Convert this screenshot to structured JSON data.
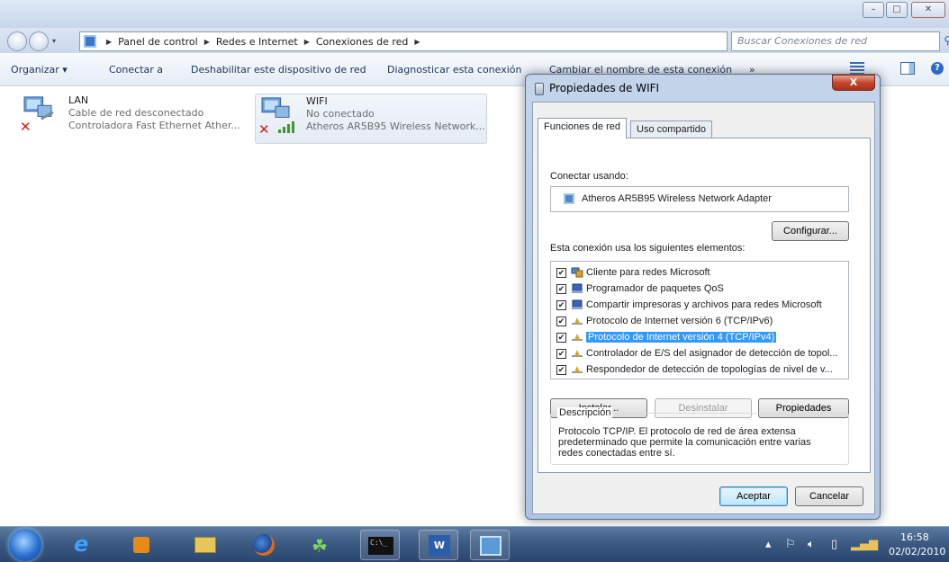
{
  "window": {
    "breadcrumb": [
      "Panel de control",
      "Redes e Internet",
      "Conexiones de red"
    ],
    "search_placeholder": "Buscar Conexiones de red",
    "toolbar": {
      "organize": "Organizar ▾",
      "connect": "Conectar a",
      "disable": "Deshabilitar este dispositivo de red",
      "diagnose": "Diagnosticar esta conexión",
      "rename": "Cambiar el nombre de esta conexión",
      "more": "»"
    }
  },
  "connections": [
    {
      "name": "LAN",
      "status": "Cable de red desconectado",
      "device": "Controladora Fast Ethernet Ather..."
    },
    {
      "name": "WIFI",
      "status": "No conectado",
      "device": "Atheros AR5B95 Wireless Network..."
    }
  ],
  "dialog": {
    "title": "Propiedades de WIFI",
    "close": "X",
    "tabs": [
      "Funciones de red",
      "Uso compartido"
    ],
    "connect_using_label": "Conectar usando:",
    "adapter": "Atheros AR5B95 Wireless Network Adapter",
    "configure": "Configurar...",
    "items_label": "Esta conexión usa los siguientes elementos:",
    "items": [
      {
        "label": "Cliente para redes Microsoft",
        "checked": true,
        "selected": false,
        "icon": "network-client-icon"
      },
      {
        "label": "Programador de paquetes QoS",
        "checked": true,
        "selected": false,
        "icon": "service-icon"
      },
      {
        "label": "Compartir impresoras y archivos para redes Microsoft",
        "checked": true,
        "selected": false,
        "icon": "service-icon"
      },
      {
        "label": "Protocolo de Internet versión 6 (TCP/IPv6)",
        "checked": true,
        "selected": false,
        "icon": "protocol-icon"
      },
      {
        "label": "Protocolo de Internet versión 4 (TCP/IPv4)",
        "checked": true,
        "selected": true,
        "icon": "protocol-icon"
      },
      {
        "label": "Controlador de E/S del asignador de detección de topol...",
        "checked": true,
        "selected": false,
        "icon": "protocol-icon"
      },
      {
        "label": "Respondedor de detección de topologías de nivel de v...",
        "checked": true,
        "selected": false,
        "icon": "protocol-icon"
      }
    ],
    "install": "Instalar...",
    "uninstall": "Desinstalar",
    "properties": "Propiedades",
    "description_title": "Descripción",
    "description": "Protocolo TCP/IP. El protocolo de red de área extensa predeterminado que permite la comunicación entre varias redes conectadas entre sí.",
    "ok": "Aceptar",
    "cancel": "Cancelar"
  },
  "taskbar": {
    "time": "16:58",
    "date": "02/02/2010"
  }
}
